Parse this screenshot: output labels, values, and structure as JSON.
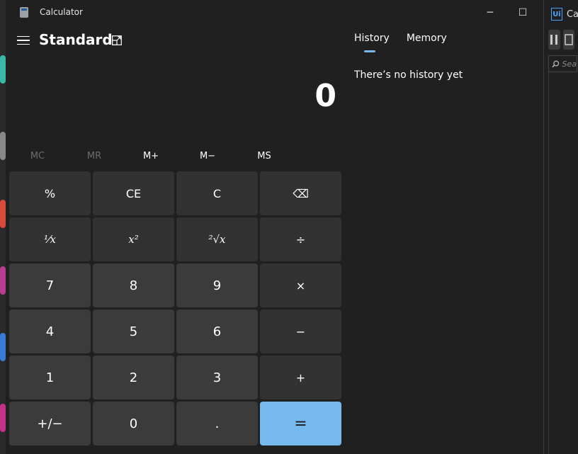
{
  "window": {
    "title": "Calculator",
    "minimize_glyph": "─",
    "maximize_glyph": "☐"
  },
  "header": {
    "mode_title": "Standard"
  },
  "display": {
    "value": "0"
  },
  "memory": [
    "MC",
    "MR",
    "M+",
    "M−",
    "MS"
  ],
  "keys": {
    "percent": "%",
    "clear_entry": "CE",
    "clear": "C",
    "backspace": "⌫",
    "reciprocal": "⅟x",
    "square": "x²",
    "sqrt": "²√x",
    "divide": "÷",
    "seven": "7",
    "eight": "8",
    "nine": "9",
    "multiply": "×",
    "four": "4",
    "five": "5",
    "six": "6",
    "minus": "−",
    "one": "1",
    "two": "2",
    "three": "3",
    "plus": "+",
    "negate": "+/−",
    "zero": "0",
    "decimal": ".",
    "equals": "="
  },
  "side": {
    "tabs": [
      "History",
      "Memory"
    ],
    "history_empty": "There’s no history yet"
  },
  "right_window": {
    "title_fragment": "Ca",
    "logo": "Ui",
    "search_fragment": "Sea"
  },
  "colors": {
    "equals_key": "#76b9ed",
    "tab_indicator": "#7cb6ea",
    "window_bg": "#202020"
  }
}
